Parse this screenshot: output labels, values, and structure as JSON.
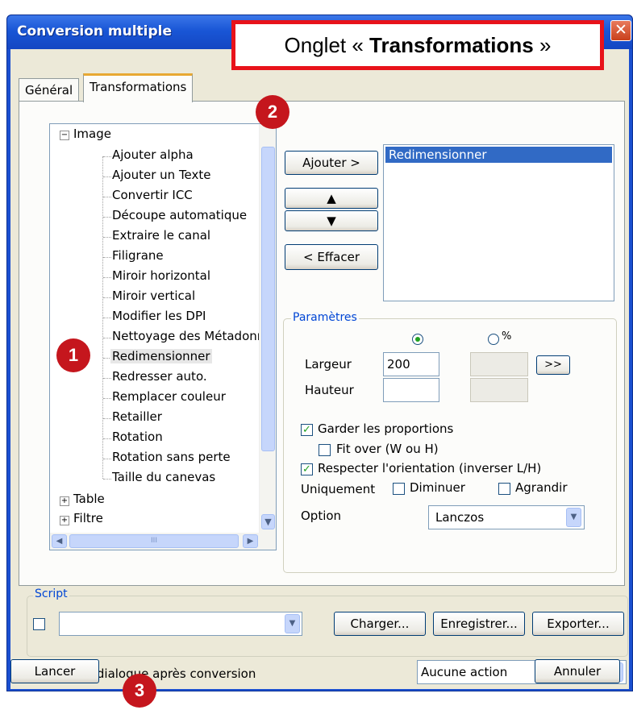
{
  "window": {
    "title": "Conversion multiple",
    "close_glyph": "✕"
  },
  "tabs": [
    {
      "label": "Général"
    },
    {
      "label": "Transformations"
    }
  ],
  "tree": {
    "items": [
      {
        "label": "Image",
        "expander": "−"
      },
      {
        "label": "Ajouter alpha"
      },
      {
        "label": "Ajouter un Texte"
      },
      {
        "label": "Convertir ICC"
      },
      {
        "label": "Découpe automatique"
      },
      {
        "label": "Extraire le canal"
      },
      {
        "label": "Filigrane"
      },
      {
        "label": "Miroir horizontal"
      },
      {
        "label": "Miroir vertical"
      },
      {
        "label": "Modifier les DPI"
      },
      {
        "label": "Nettoyage des Métadonnées"
      },
      {
        "label": "Redimensionner"
      },
      {
        "label": "Redresser auto."
      },
      {
        "label": "Remplacer couleur"
      },
      {
        "label": "Retailler"
      },
      {
        "label": "Rotation"
      },
      {
        "label": "Rotation sans perte"
      },
      {
        "label": "Taille du canevas"
      },
      {
        "label": "Table",
        "expander": "+"
      },
      {
        "label": "Filtre",
        "expander": "+"
      }
    ],
    "selected": "Redimensionner",
    "scroll_glyphs": {
      "down": "▼",
      "left": "◀",
      "right": "▶",
      "grip": "III"
    }
  },
  "buttons": {
    "ajouter": "Ajouter >",
    "up_glyph": "▲",
    "down_glyph": "▼",
    "effacer": "< Effacer",
    "charger": "Charger...",
    "enregistrer": "Enregistrer...",
    "exporter": "Exporter...",
    "lancer": "Lancer",
    "annuler": "Annuler"
  },
  "selected_list": {
    "items": [
      "Redimensionner"
    ]
  },
  "parametres": {
    "legend": "Paramètres",
    "unit_pixels_selected": true,
    "unit_percent_label": "%",
    "largeur_label": "Largeur",
    "largeur_value": "200",
    "hauteur_label": "Hauteur",
    "hauteur_value": "",
    "expand_button": ">>",
    "garder_proportions": {
      "label": "Garder les proportions",
      "checked": true
    },
    "fit_over": {
      "label": "Fit over (W ou H)",
      "checked": false
    },
    "respecter_orientation": {
      "label": "Respecter l'orientation (inverser L/H)",
      "checked": true
    },
    "uniquement_label": "Uniquement",
    "diminuer": {
      "label": "Diminuer",
      "checked": false
    },
    "agrandir": {
      "label": "Agrandir",
      "checked": false
    },
    "option_label": "Option",
    "option_value": "Lanczos"
  },
  "script": {
    "legend": "Script",
    "value": ""
  },
  "footer": {
    "fermer": {
      "label": "Fermer le dialogue après conversion",
      "checked": true
    },
    "action_value": "Aucune action"
  },
  "annotations": {
    "banner_prefix": "Onglet « ",
    "banner_bold": "Transformations",
    "banner_suffix": " »",
    "badges": [
      "1",
      "2",
      "3"
    ]
  },
  "colors": {
    "title_bar": "#1956d6",
    "selection": "#316ac5",
    "badge": "#c5161d",
    "banner_border": "#e8131a"
  },
  "icons": {
    "check": "✓",
    "combo_arrow": "▼"
  }
}
